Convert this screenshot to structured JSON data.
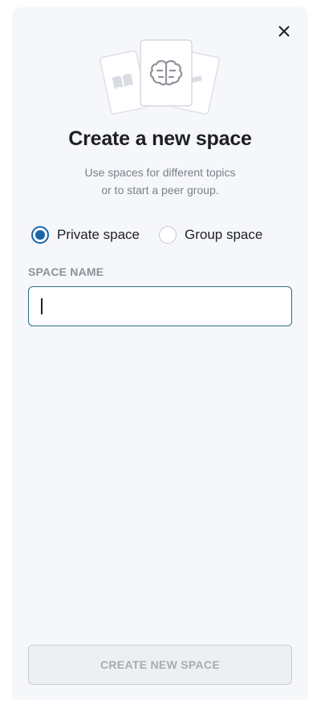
{
  "modal": {
    "title": "Create a new space",
    "subtitle_line1": "Use spaces for different topics",
    "subtitle_line2": "or to start a peer group.",
    "close_icon": "close-icon",
    "illustration_icon": "brain-icon"
  },
  "space_type": {
    "options": [
      {
        "label": "Private space",
        "checked": true
      },
      {
        "label": "Group space",
        "checked": false
      }
    ]
  },
  "space_name": {
    "label": "SPACE NAME",
    "value": "",
    "placeholder": ""
  },
  "actions": {
    "create_label": "CREATE NEW SPACE",
    "create_disabled": true
  },
  "colors": {
    "accent": "#1866a8",
    "input_border": "#2a6c8a",
    "panel_bg": "#f6f7fb",
    "title": "#1d1f24",
    "muted": "#7a7f88"
  }
}
